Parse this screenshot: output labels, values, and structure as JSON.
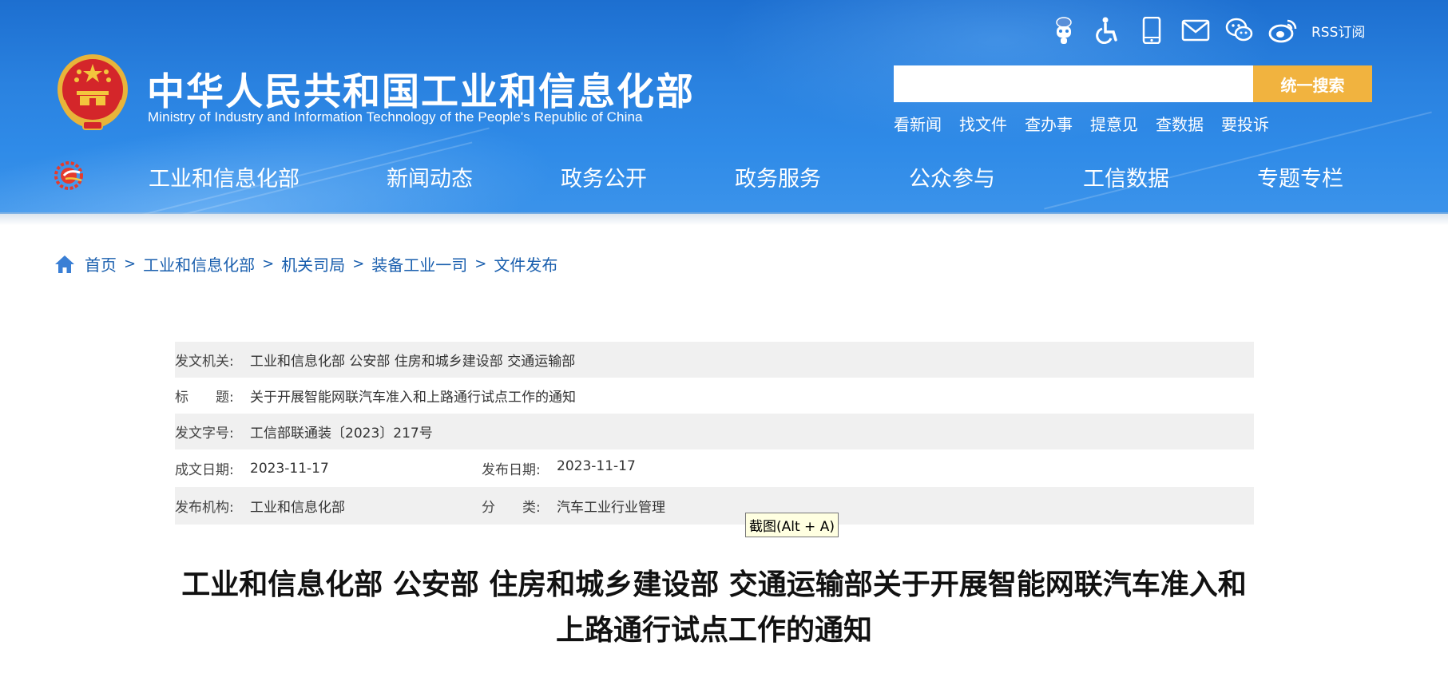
{
  "header": {
    "site_title": "中华人民共和国工业和信息化部",
    "site_subtitle": "Ministry of Industry and Information Technology of the People's Republic of China",
    "top_icons": [
      "robot-icon",
      "accessibility-icon",
      "mobile-icon",
      "mail-icon",
      "wechat-icon",
      "weibo-icon"
    ],
    "rss_label": "RSS订阅",
    "search": {
      "placeholder": "",
      "button_label": "统一搜索"
    },
    "quick_links": [
      "看新闻",
      "找文件",
      "查办事",
      "提意见",
      "查数据",
      "要投诉"
    ],
    "nav": [
      "工业和信息化部",
      "新闻动态",
      "政务公开",
      "政务服务",
      "公众参与",
      "工信数据",
      "专题专栏"
    ]
  },
  "breadcrumb": [
    "首页",
    "工业和信息化部",
    "机关司局",
    "装备工业一司",
    "文件发布"
  ],
  "info": {
    "issuer_label": "发文机关:",
    "issuer": "工业和信息化部 公安部 住房和城乡建设部 交通运输部",
    "title_label": "标　　题:",
    "title": "关于开展智能网联汽车准入和上路通行试点工作的通知",
    "doc_no_label": "发文字号:",
    "doc_no": "工信部联通装〔2023〕217号",
    "written_date_label": "成文日期:",
    "written_date": "2023-11-17",
    "publish_date_label": "发布日期:",
    "publish_date": "2023-11-17",
    "publisher_label": "发布机构:",
    "publisher": "工业和信息化部",
    "category_label": "分　　类:",
    "category": "汽车工业行业管理"
  },
  "tooltip": "截图(Alt + A)",
  "doc_title_line1": "工业和信息化部 公安部 住房和城乡建设部 交通运输部关于开展智能网联汽车准入和",
  "doc_title_line2": "上路通行试点工作的通知",
  "colors": {
    "header_blue": "#2a82e0",
    "search_button": "#f1b33f",
    "link_blue": "#1a5fae"
  }
}
